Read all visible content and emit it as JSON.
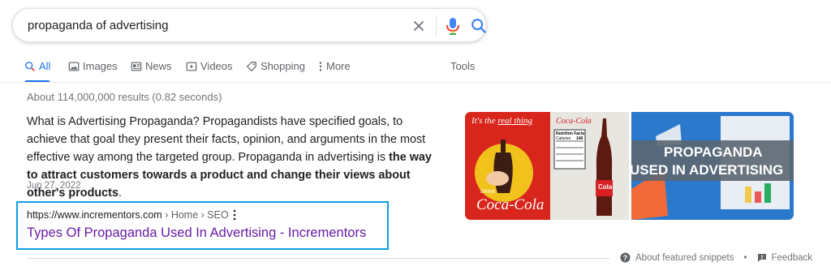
{
  "search": {
    "query": "propaganda of advertising"
  },
  "tabs": [
    {
      "label": "All",
      "icon": "search-icon"
    },
    {
      "label": "Images",
      "icon": "image-icon"
    },
    {
      "label": "News",
      "icon": "news-icon"
    },
    {
      "label": "Videos",
      "icon": "video-icon"
    },
    {
      "label": "Shopping",
      "icon": "tag-icon"
    },
    {
      "label": "More",
      "icon": "more-vert-icon"
    }
  ],
  "tools_label": "Tools",
  "result_stats": "About 114,000,000 results (0.82 seconds)",
  "snippet": {
    "text_plain": "What is Advertising Propaganda? Propagandists have specified goals, to achieve that goal they present their facts, opinion, and arguments in the most effective way among the targeted group. Propaganda in advertising is ",
    "text_bold": "the way to attract customers towards a product and change their views about other's products",
    "text_end": ".",
    "date": "Jun 27, 2022"
  },
  "result": {
    "url": "https://www.incrementors.com",
    "breadcrumb": " › Home › SEO",
    "title": "Types Of Propaganda Used In Advertising - Incrementors"
  },
  "images": {
    "left": {
      "headline_1": "It's the ",
      "headline_2": "real thing",
      "logo": "Coca-Cola",
      "drink_label": "DRINK",
      "can_label": "Cola",
      "panel_title": "Nutrition Facts",
      "panel_calories": "Calories",
      "panel_cal_value": "140"
    },
    "right": {
      "line1": "PROPAGANDA",
      "line2": "USED IN ADVERTISING"
    }
  },
  "footer": {
    "about_label": "About featured snippets",
    "separator": "•",
    "feedback_label": "Feedback"
  },
  "colors": {
    "accent": "#1a73e8",
    "visited_link": "#681da8",
    "highlight_box": "#0ea0e0"
  }
}
